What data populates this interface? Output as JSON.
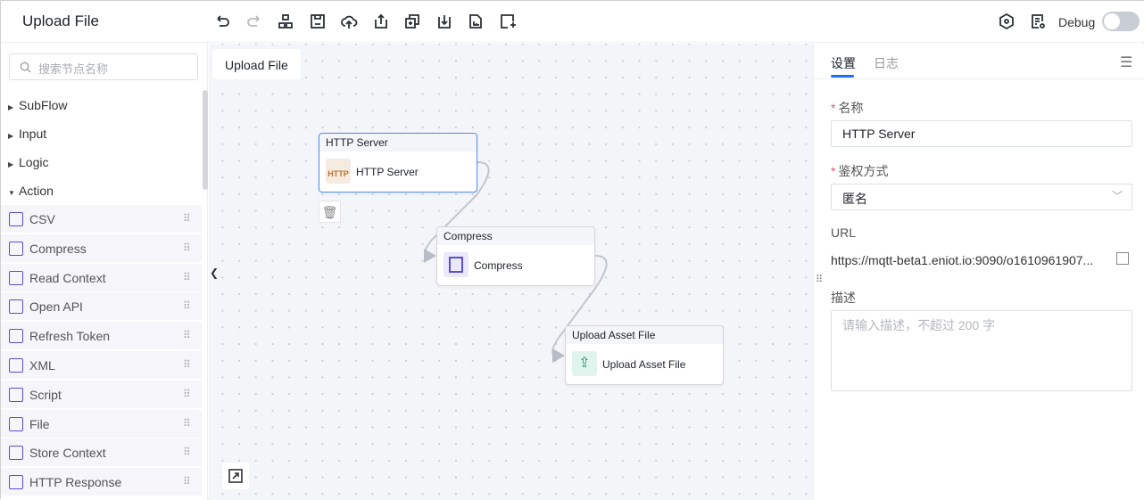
{
  "header": {
    "title": "Upload File",
    "debug_label": "Debug",
    "debug_on": false,
    "toolbar": [
      "undo-icon",
      "redo-icon",
      "layout-icon",
      "save-icon",
      "cloud-upload-icon",
      "export-icon",
      "copy-icon",
      "import-icon",
      "report-icon",
      "add-grid-icon"
    ],
    "right_icons": [
      "settings-hex-icon",
      "doc-settings-icon"
    ]
  },
  "sidebar": {
    "search_placeholder": "搜索节点名称",
    "groups": [
      {
        "label": "SubFlow",
        "expanded": false
      },
      {
        "label": "Input",
        "expanded": false
      },
      {
        "label": "Logic",
        "expanded": false
      },
      {
        "label": "Action",
        "expanded": true
      }
    ],
    "items": [
      {
        "label": "CSV"
      },
      {
        "label": "Compress"
      },
      {
        "label": "Read Context"
      },
      {
        "label": "Open API"
      },
      {
        "label": "Refresh Token"
      },
      {
        "label": "XML"
      },
      {
        "label": "Script"
      },
      {
        "label": "File"
      },
      {
        "label": "Store Context"
      },
      {
        "label": "HTTP Response"
      }
    ]
  },
  "canvas": {
    "tab": "Upload File",
    "nodes": [
      {
        "header": "HTTP Server",
        "label": "HTTP Server",
        "icon": "http-icon",
        "color": "#c0702a"
      },
      {
        "header": "Compress",
        "label": "Compress",
        "icon": "compress-icon",
        "color": "#5a4fcf"
      },
      {
        "header": "Upload Asset File",
        "label": "Upload Asset File",
        "icon": "upload-file-icon",
        "color": "#1f9a70"
      }
    ]
  },
  "panel": {
    "tabs": [
      "设置",
      "日志"
    ],
    "active_tab": 0,
    "name_label": "名称",
    "name_value": "HTTP Server",
    "auth_label": "鉴权方式",
    "auth_value": "匿名",
    "url_label": "URL",
    "url_value": "https://mqtt-beta1.eniot.io:9090/o1610961907...",
    "desc_label": "描述",
    "desc_placeholder": "请输入描述，不超过 200 字"
  },
  "colors": {
    "accent": "#1e6fff",
    "node_selected": "#4e8cf7",
    "required": "#e4586a"
  }
}
